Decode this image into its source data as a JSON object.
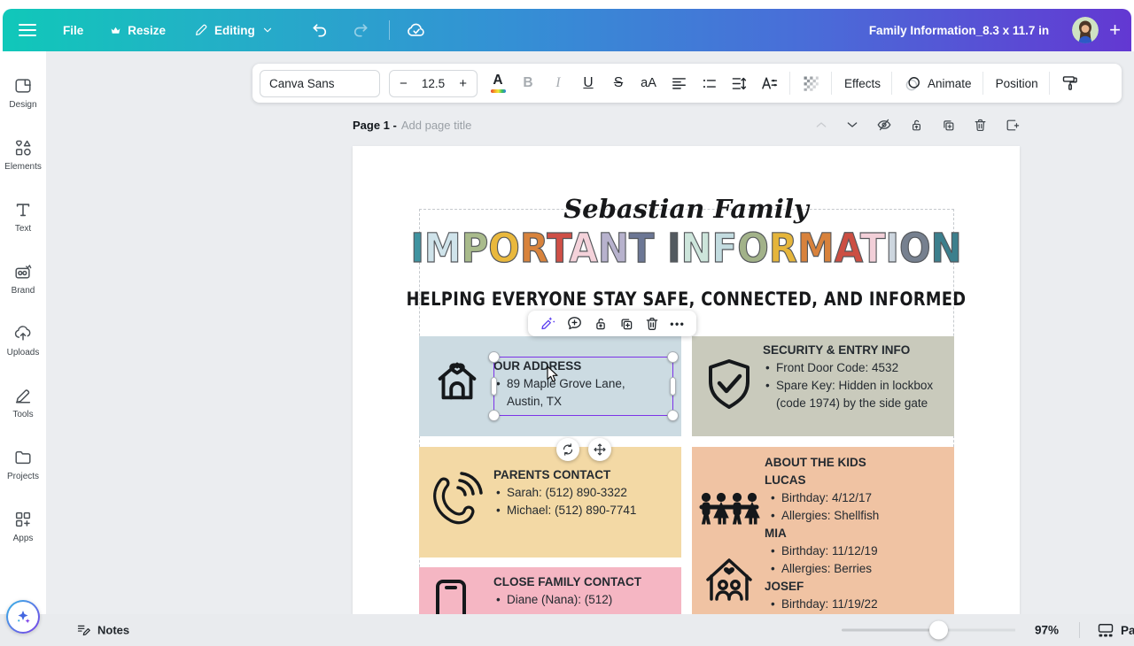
{
  "colors": {
    "topbar_gradient_start": "#10c8b9",
    "topbar_gradient_end": "#6338d2",
    "selection_accent": "#7c33e8",
    "card_address_bg": "#ccdbe2",
    "card_security_bg": "#c9cabc",
    "card_parents_bg": "#f3d9a5",
    "card_kids_bg": "#f0c3a3",
    "card_family_bg": "#f5b6c3"
  },
  "topbar": {
    "file_label": "File",
    "resize_label": "Resize",
    "editing_label": "Editing",
    "doc_title": "Family Information_8.3 x 11.7 in",
    "plus_glyph": "+"
  },
  "sidebar": {
    "items": [
      "Design",
      "Elements",
      "Text",
      "Brand",
      "Uploads",
      "Tools",
      "Projects",
      "Apps"
    ]
  },
  "toolbar": {
    "font_name": "Canva Sans",
    "font_size": "12.5",
    "minus_glyph": "−",
    "plus_glyph": "+",
    "color_glyph": "A",
    "bold_glyph": "B",
    "italic_glyph": "I",
    "underline_glyph": "U",
    "strikethrough_glyph": "S",
    "case_glyph": "aA",
    "effects_label": "Effects",
    "animate_label": "Animate",
    "position_label": "Position"
  },
  "page_header": {
    "page_label": "Page 1 -",
    "title_placeholder": "Add page title"
  },
  "float_toolbar": {
    "more_glyph": "•••"
  },
  "canvas": {
    "family_title": "Sebastian Family",
    "main_title": "IMPORTANT INFORMATION",
    "title_letters": [
      {
        "ch": "I",
        "color": "#3f93a0"
      },
      {
        "ch": "M",
        "color": "#cfe3ea"
      },
      {
        "ch": "P",
        "color": "#a9bb8c"
      },
      {
        "ch": "O",
        "color": "#e9b83d"
      },
      {
        "ch": "R",
        "color": "#d8833c"
      },
      {
        "ch": "T",
        "color": "#cf4f46"
      },
      {
        "ch": "A",
        "color": "#f4d2da"
      },
      {
        "ch": "N",
        "color": "#b7b2cd"
      },
      {
        "ch": "T",
        "color": "#6c7795"
      },
      {
        "ch": " ",
        "color": "#000000"
      },
      {
        "ch": "I",
        "color": "#535a60"
      },
      {
        "ch": "N",
        "color": "#cde5db"
      },
      {
        "ch": "F",
        "color": "#c3dce0"
      },
      {
        "ch": "O",
        "color": "#a2b289"
      },
      {
        "ch": "R",
        "color": "#e5b53b"
      },
      {
        "ch": "M",
        "color": "#d8823c"
      },
      {
        "ch": "A",
        "color": "#cc4e42"
      },
      {
        "ch": "T",
        "color": "#f2cfd8"
      },
      {
        "ch": "I",
        "color": "#cdd6df"
      },
      {
        "ch": "O",
        "color": "#76808f"
      },
      {
        "ch": "N",
        "color": "#3c7f8d"
      }
    ],
    "subtitle": "HELPING EVERYONE STAY SAFE, CONNECTED, AND INFORMED",
    "cards": {
      "address": {
        "title": "OUR ADDRESS",
        "bullet1": "89 Maple Grove Lane, Austin, TX"
      },
      "security": {
        "title": "SECURITY & ENTRY INFO",
        "bullet1": "Front Door Code: 4532",
        "bullet2": "Spare Key: Hidden in lockbox (code 1974) by the side gate"
      },
      "parents": {
        "title": "PARENTS CONTACT",
        "bullet1": "Sarah: (512) 890-3322",
        "bullet2": "Michael: (512) 890-7741"
      },
      "kids": {
        "title": "ABOUT THE KIDS",
        "kid1_name": "LUCAS",
        "kid1_b1": "Birthday: 4/12/17",
        "kid1_b2": "Allergies: Shellfish",
        "kid2_name": "MIA",
        "kid2_b1": "Birthday: 11/12/19",
        "kid2_b2": "Allergies: Berries",
        "kid3_name": "JOSEF",
        "kid3_b1": "Birthday: 11/19/22"
      },
      "family": {
        "title": "CLOSE FAMILY CONTACT",
        "bullet1": "Diane (Nana): (512)"
      }
    }
  },
  "statusbar": {
    "notes_label": "Notes",
    "zoom_level": "97%",
    "pages_label": "Pa"
  }
}
